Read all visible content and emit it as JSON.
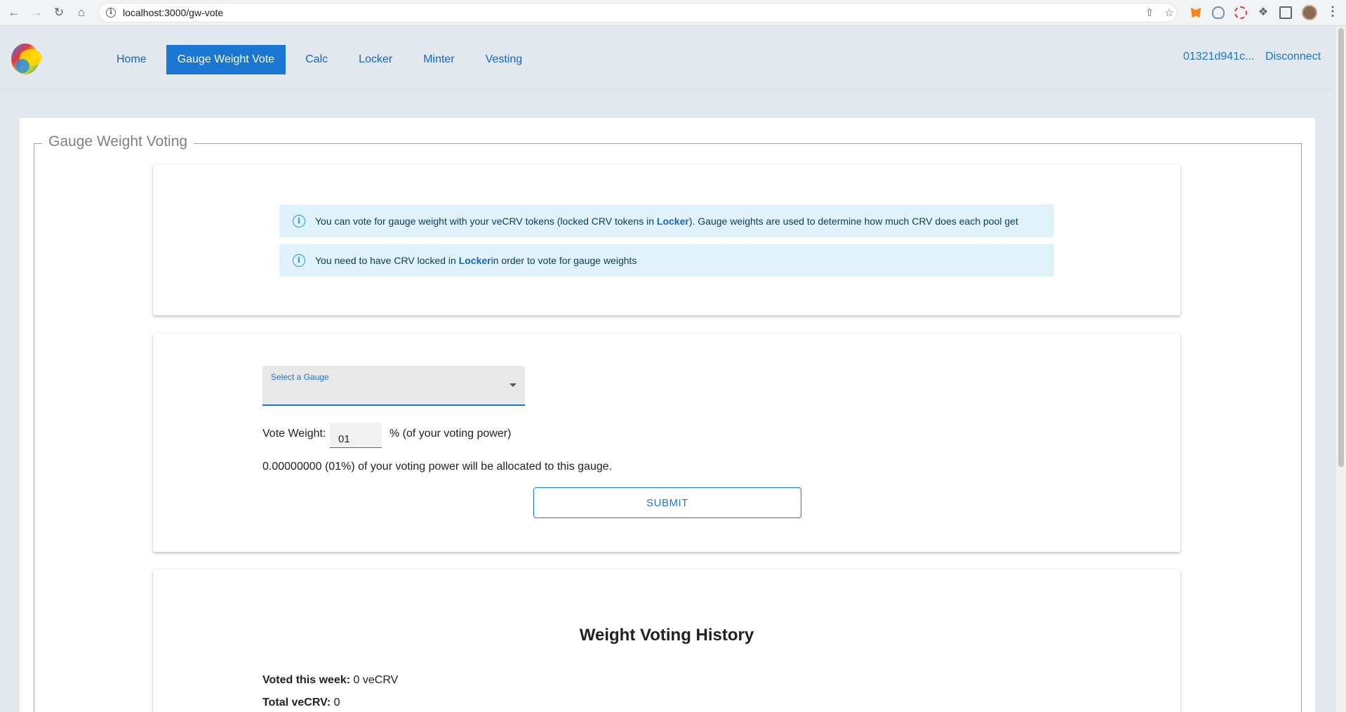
{
  "browser": {
    "url": "localhost:3000/gw-vote"
  },
  "nav": {
    "items": [
      "Home",
      "Gauge Weight Vote",
      "Calc",
      "Locker",
      "Minter",
      "Vesting"
    ],
    "active_index": 1
  },
  "account": {
    "address": "01321d941c...",
    "disconnect_label": "Disconnect"
  },
  "page": {
    "legend": "Gauge Weight Voting"
  },
  "info": {
    "alert1_pre": "You can vote for gauge weight with your veCRV tokens (locked CRV tokens in ",
    "alert1_link": "Locker",
    "alert1_post": "). Gauge weights are used to determine how much CRV does each pool get",
    "alert2_pre": "You need to have CRV locked in ",
    "alert2_link": "Locker",
    "alert2_post": "in order to vote for gauge weights"
  },
  "vote": {
    "select_label": "Select a Gauge",
    "weight_label": "Vote Weight:",
    "weight_value": "01",
    "weight_suffix": "% (of your voting power)",
    "allocation_text": "0.00000000 (01%) of your voting power will be allocated to this gauge.",
    "submit_label": "SUBMIT"
  },
  "history": {
    "title": "Weight Voting History",
    "voted_label": "Voted this week:",
    "voted_value": "0 veCRV",
    "total_label": "Total veCRV:",
    "total_value": "0"
  },
  "colors": {
    "primary": "#1976d2",
    "background": "#e2e8ee",
    "alert_bg": "#e1f3fa"
  }
}
